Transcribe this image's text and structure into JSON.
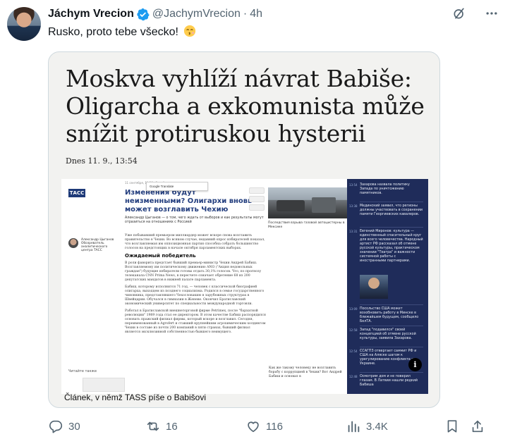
{
  "author": {
    "display_name": "Jáchym Vrecion",
    "handle": "@JachymVrecion",
    "separator": "·",
    "time": "4h",
    "verified_color": "#1d9bf0"
  },
  "top_actions": {
    "grok_icon": "slash-circle-icon",
    "more_icon": "more-horizontal-icon"
  },
  "tweet": {
    "text": "Rusko, proto tebe všecko!",
    "emoji": "kissing-face-emoji"
  },
  "media": {
    "headline": "Moskva vyhlíží návrat Babiše: Oligarcha a exkomunista může snížit protiruskou hysterii",
    "dateline": "Dnes 11. 9., 13:54",
    "caption": "Článek, v němž TASS píše o Babišovi",
    "info_label": "i",
    "embedded": {
      "logo": "ТАСС",
      "meta_top": "11 сентября, 11:26 · Зарубежье",
      "title": "Изменения будут неизменными? Олигархи вновь может возглавить Чехию",
      "lead": "Александр Цыганов — о том, чего ждать от выборов и как результаты могут отразиться на отношениях с Россией",
      "photo_caption": "Последствия взрыва газовой автоцистерны в Мексике",
      "author_name": "Александр Цыганов Обозреватель аналитического центра ТАСС",
      "body_p1": "Уже побывавший премьером миллиардер может вскоре снова возглавить правительство в Чехии. Во всяком случае, недавний опрос избирателей показал, что возглавляемая им оппозиционная партия способна собрать большинство голосов на предстоящих в начале октября парламентских выборах.",
      "subhead": "Ожидаемый победитель",
      "body_p2": "В роли фаворита предстает бывший премьер-министр Чехии Андрей Бабиш. Возглавляемому им политическому движению ANO (\"Акция недовольных граждан\") будущие избиратели готовы отдать 30,1% голосов. Что, по прогнозу телеканала CNN Prima News, в пересчете означает обретение 68 из 200 депутатских мандатов в нижней палате парламента.",
      "body_p3": "Бабиш, которому исполнится 71 год, — человек с классической биографией олигарха, выходцем из позднего социализма. Родился в семье государственного чиновника, представлявшего Чехословакию в зарубежных структурах в Швейцарии. Обучался в гимназии в Женеве. Окончил Братиславский экономический университет по специальности международной торговли.",
      "body_p4": "Работал в Братиславской внешнеторговой фирме Petrimex, после \"бархатной революции\" 1989 года стал ее директором. В этом качестве Бабиш распорядился основать пражский филиал фирмы, который вскоре и возглавил. Сегодня, переименованный в Agrofert и ставший крупнейшим агрохимическим холдингом Чехии в составе из почти 200 компаний в пяти странах, бывший филиал является эксклюзивной собственностью бывшего неимущего.",
      "read_also": "Читайте также",
      "footnote": "Как же такому человеку не возглавить борьбу с коррупцией в Чехии? Вот Андрей Бабиш и основал в",
      "google_translate": "Google Translate",
      "feed": [
        {
          "t": "13:54",
          "x": "Захарова назвала политику Запада по уничтожению памятников."
        },
        {
          "t": "13:38",
          "x": "Мединский заявил, что регионы должны участвовать в сохранении памяти Георгиевских кавалеров."
        },
        {
          "t": "13:31",
          "x": "Евгений Миронов: культура — единственный спасительный круг для всего человечества. Народный артист РФ рассказал об отмене русской культуры, практическом значении \"Театра\" и важности системной работы с иностранными партнерами."
        },
        {
          "t": "13:09",
          "x": "Посольство США может возобновить работу в Минске в ближайшем будущем, сообщило БелТА."
        },
        {
          "t": "12:58",
          "x": "Запад \"подавился\" своей концепцией об отмене русской культуры, заявила Захарова."
        },
        {
          "t": "12:54",
          "x": "ССАГПЗ отвергает саммит РФ и США на Аляске шагом к урегулированию конфликта на Украине."
        },
        {
          "t": "12:48",
          "x": "Осмотрим дом и не поверил глазам. В Латвии нашли редкий Бабиша"
        }
      ]
    }
  },
  "engagement": {
    "replies": "30",
    "reposts": "16",
    "likes": "116",
    "views": "3.4K",
    "icons": [
      "reply-icon",
      "repost-icon",
      "like-icon",
      "views-icon",
      "bookmark-icon",
      "share-icon"
    ]
  }
}
